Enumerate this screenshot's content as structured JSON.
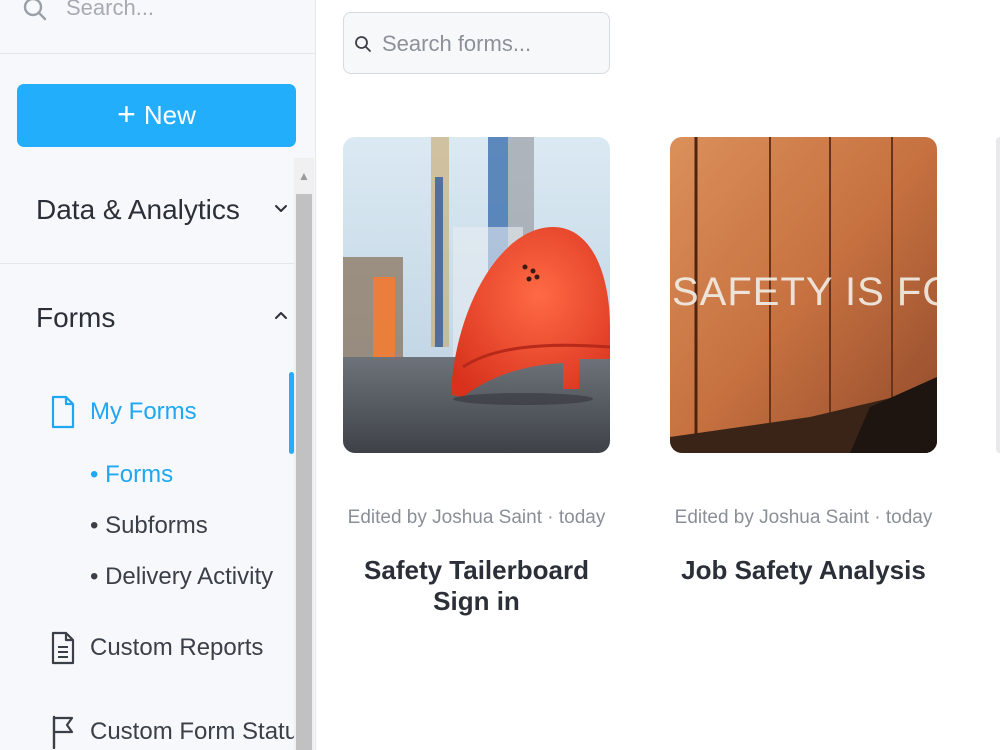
{
  "sidebar": {
    "search_placeholder": "Search...",
    "new_button": {
      "plus": "+",
      "label": "New"
    },
    "sections": {
      "data_analytics": {
        "title": "Data & Analytics",
        "expanded": false
      },
      "forms": {
        "title": "Forms",
        "expanded": true,
        "items": {
          "my_forms": {
            "label": "My Forms",
            "icon": "file-icon",
            "active": true
          },
          "custom_reports": {
            "label": "Custom Reports",
            "icon": "document-icon"
          },
          "custom_form_status": {
            "label": "Custom Form Status",
            "icon": "flag-icon"
          }
        },
        "sub_items": [
          "• Forms",
          "• Subforms",
          "• Delivery Activity"
        ]
      }
    }
  },
  "main": {
    "search_placeholder": "Search forms...",
    "cards": [
      {
        "meta": "Edited by Joshua Saint · today",
        "title": "Safety Tailerboard Sign in",
        "image": "red hard hat on asphalt"
      },
      {
        "meta": "Edited by Joshua Saint · today",
        "title": "Job Safety Analysis",
        "image": "rusty railcar with SAFETY IS FOR TODAY text",
        "image_text": "SAFETY IS FOR TODAY"
      }
    ]
  },
  "colors": {
    "accent": "#23aefc",
    "sidebar_bg": "#f7f8fb",
    "text": "#2b2f38",
    "muted": "#8a8f97"
  }
}
